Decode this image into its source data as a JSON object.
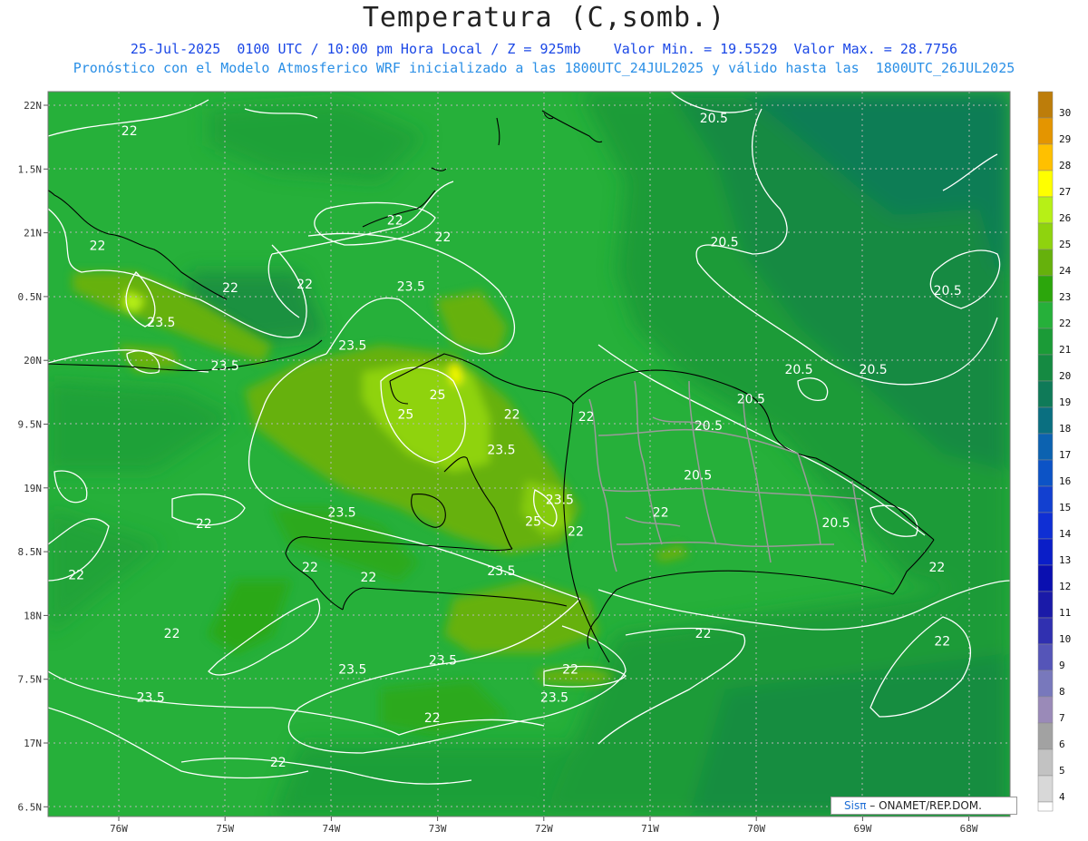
{
  "header": {
    "title": "Temperatura (C,somb.)",
    "line1_left": "25-Jul-2025  0100 UTC / 10:00 pm Hora Local / Z = 925mb",
    "line1_min": "Valor Min. = 19.5529",
    "line1_max": "Valor Max. = 28.7756",
    "line2": "Pronóstico con el Modelo Atmosferico WRF inicializado a las 1800UTC_24JUL2025 y válido hasta las  1800UTC_26JUL2025"
  },
  "map": {
    "lon_range": [
      -76.65,
      -67.6
    ],
    "lat_range": [
      16.45,
      22.1
    ],
    "lat_ticks": [
      {
        "value": 22,
        "label": "22N"
      },
      {
        "value": 21.5,
        "label": "1.5N"
      },
      {
        "value": 21,
        "label": "21N"
      },
      {
        "value": 20.5,
        "label": "0.5N"
      },
      {
        "value": 20,
        "label": "20N"
      },
      {
        "value": 19.5,
        "label": "9.5N"
      },
      {
        "value": 19,
        "label": "19N"
      },
      {
        "value": 18.5,
        "label": "8.5N"
      },
      {
        "value": 18,
        "label": "18N"
      },
      {
        "value": 17.5,
        "label": "7.5N"
      },
      {
        "value": 17,
        "label": "17N"
      },
      {
        "value": 16.5,
        "label": "6.5N"
      }
    ],
    "lon_ticks": [
      {
        "value": -76,
        "label": "76W"
      },
      {
        "value": -75,
        "label": "75W"
      },
      {
        "value": -74,
        "label": "74W"
      },
      {
        "value": -73,
        "label": "73W"
      },
      {
        "value": -72,
        "label": "72W"
      },
      {
        "value": -71,
        "label": "71W"
      },
      {
        "value": -70,
        "label": "70W"
      },
      {
        "value": -69,
        "label": "69W"
      },
      {
        "value": -68,
        "label": "68W"
      }
    ],
    "contour_labels": [
      {
        "text": "20.5",
        "lon": -70.4,
        "lat": 21.9
      },
      {
        "text": "22",
        "lon": -75.9,
        "lat": 21.8
      },
      {
        "text": "22",
        "lon": -73.4,
        "lat": 21.1
      },
      {
        "text": "22",
        "lon": -72.95,
        "lat": 20.97
      },
      {
        "text": "20.5",
        "lon": -70.3,
        "lat": 20.93
      },
      {
        "text": "22",
        "lon": -76.2,
        "lat": 20.9
      },
      {
        "text": "20.5",
        "lon": -68.2,
        "lat": 20.55
      },
      {
        "text": "22",
        "lon": -74.95,
        "lat": 20.57
      },
      {
        "text": "22",
        "lon": -74.25,
        "lat": 20.6
      },
      {
        "text": "23.5",
        "lon": -73.25,
        "lat": 20.58
      },
      {
        "text": "23.5",
        "lon": -75.6,
        "lat": 20.3
      },
      {
        "text": "23.5",
        "lon": -73.8,
        "lat": 20.12
      },
      {
        "text": "23.5",
        "lon": -75.0,
        "lat": 19.96
      },
      {
        "text": "20.5",
        "lon": -69.6,
        "lat": 19.93
      },
      {
        "text": "20.5",
        "lon": -68.9,
        "lat": 19.93
      },
      {
        "text": "25",
        "lon": -73.0,
        "lat": 19.73
      },
      {
        "text": "20.5",
        "lon": -70.05,
        "lat": 19.7
      },
      {
        "text": "25",
        "lon": -73.3,
        "lat": 19.58
      },
      {
        "text": "22",
        "lon": -72.3,
        "lat": 19.58
      },
      {
        "text": "22",
        "lon": -71.6,
        "lat": 19.56
      },
      {
        "text": "20.5",
        "lon": -70.45,
        "lat": 19.49
      },
      {
        "text": "23.5",
        "lon": -72.4,
        "lat": 19.3
      },
      {
        "text": "20.5",
        "lon": -70.55,
        "lat": 19.1
      },
      {
        "text": "23.5",
        "lon": -71.85,
        "lat": 18.91
      },
      {
        "text": "23.5",
        "lon": -73.9,
        "lat": 18.81
      },
      {
        "text": "22",
        "lon": -75.2,
        "lat": 18.72
      },
      {
        "text": "25",
        "lon": -72.1,
        "lat": 18.74
      },
      {
        "text": "22",
        "lon": -71.7,
        "lat": 18.66
      },
      {
        "text": "22",
        "lon": -70.9,
        "lat": 18.81
      },
      {
        "text": "20.5",
        "lon": -69.25,
        "lat": 18.73
      },
      {
        "text": "22",
        "lon": -74.2,
        "lat": 18.38
      },
      {
        "text": "22",
        "lon": -73.65,
        "lat": 18.3
      },
      {
        "text": "23.5",
        "lon": -72.4,
        "lat": 18.35
      },
      {
        "text": "22",
        "lon": -76.4,
        "lat": 18.32
      },
      {
        "text": "22",
        "lon": -68.3,
        "lat": 18.38
      },
      {
        "text": "22",
        "lon": -70.5,
        "lat": 17.86
      },
      {
        "text": "22",
        "lon": -68.25,
        "lat": 17.8
      },
      {
        "text": "22",
        "lon": -75.5,
        "lat": 17.86
      },
      {
        "text": "23.5",
        "lon": -73.8,
        "lat": 17.58
      },
      {
        "text": "22",
        "lon": -71.75,
        "lat": 17.58
      },
      {
        "text": "23.5",
        "lon": -72.95,
        "lat": 17.65
      },
      {
        "text": "23.5",
        "lon": -75.7,
        "lat": 17.36
      },
      {
        "text": "23.5",
        "lon": -71.9,
        "lat": 17.36
      },
      {
        "text": "22",
        "lon": -73.05,
        "lat": 17.2
      },
      {
        "text": "22",
        "lon": -74.5,
        "lat": 16.85
      }
    ]
  },
  "colorbar": {
    "levels": [
      "30",
      "29",
      "28",
      "27",
      "26",
      "25",
      "24",
      "23",
      "22",
      "21",
      "20",
      "19",
      "18",
      "17",
      "16",
      "15",
      "14",
      "13",
      "12",
      "11",
      "10",
      "9",
      "8",
      "7",
      "6",
      "5",
      "4"
    ],
    "colors": [
      "#bd7d0a",
      "#e49500",
      "#ffc000",
      "#ffff00",
      "#b7f016",
      "#8fd30e",
      "#66b10c",
      "#2ca60c",
      "#26b03a",
      "#1b9b37",
      "#158a42",
      "#0f7a58",
      "#0a6f80",
      "#0c62b0",
      "#0c53c6",
      "#1240d0",
      "#0f2fd4",
      "#0a1ec8",
      "#0a0fb0",
      "#1a1aa8",
      "#3030b0",
      "#5555b8",
      "#7878bc",
      "#9a8ab8",
      "#a2a2a2",
      "#c2c2c2",
      "#d8d8d8"
    ]
  },
  "credit": {
    "brand": "Sisπ",
    "text": " – ONAMET/REP.DOM."
  }
}
